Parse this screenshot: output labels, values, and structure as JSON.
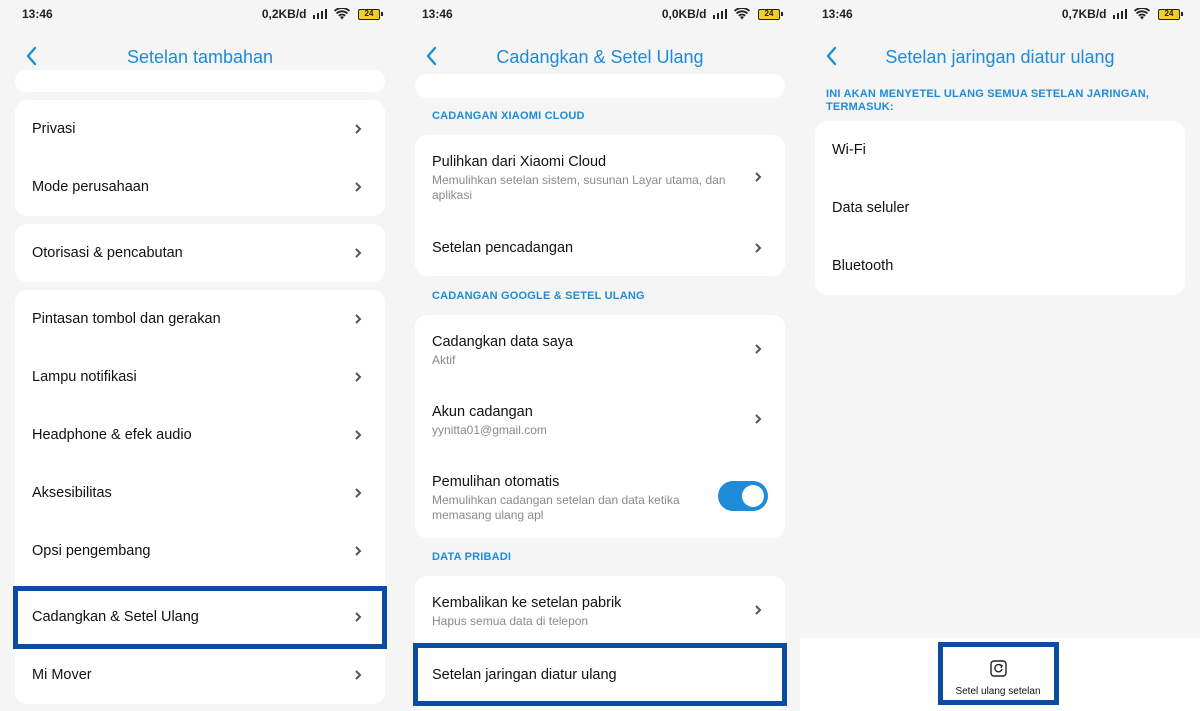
{
  "status": [
    {
      "time": "13:46",
      "speed": "0,2KB/d",
      "battery": "24"
    },
    {
      "time": "13:46",
      "speed": "0,0KB/d",
      "battery": "24"
    },
    {
      "time": "13:46",
      "speed": "0,7KB/d",
      "battery": "24"
    }
  ],
  "screen1": {
    "title": "Setelan tambahan",
    "items": [
      "Privasi",
      "Mode perusahaan",
      "Otorisasi & pencabutan",
      "Pintasan tombol dan gerakan",
      "Lampu notifikasi",
      "Headphone & efek audio",
      "Aksesibilitas",
      "Opsi pengembang",
      "Cadangkan & Setel Ulang",
      "Mi Mover"
    ]
  },
  "screen2": {
    "title": "Cadangkan & Setel Ulang",
    "section_xiaomi": "CADANGAN XIAOMI CLOUD",
    "restore_title": "Pulihkan dari Xiaomi Cloud",
    "restore_sub": "Memulihkan setelan sistem, susunan Layar utama, dan aplikasi",
    "backup_settings": "Setelan pencadangan",
    "section_google": "CADANGAN GOOGLE & SETEL ULANG",
    "backup_data_title": "Cadangkan data saya",
    "backup_data_sub": "Aktif",
    "account_title": "Akun cadangan",
    "account_sub": "yynitta01@gmail.com",
    "auto_restore_title": "Pemulihan otomatis",
    "auto_restore_sub": "Memulihkan cadangan setelan dan data ketika memasang ulang apl",
    "auto_restore_on": true,
    "section_personal": "DATA PRIBADI",
    "factory_title": "Kembalikan ke setelan pabrik",
    "factory_sub": "Hapus semua data di telepon",
    "network_reset": "Setelan jaringan diatur ulang"
  },
  "screen3": {
    "title": "Setelan jaringan diatur ulang",
    "notice": "INI AKAN MENYETEL ULANG SEMUA SETELAN JARINGAN, TERMASUK:",
    "items": [
      "Wi-Fi",
      "Data seluler",
      "Bluetooth"
    ],
    "reset_button": "Setel ulang setelan"
  },
  "icons": {
    "back": "chevron-left-icon",
    "chevron": "chevron-right-icon",
    "wifi": "wifi-icon",
    "signal": "signal-icon",
    "battery": "battery-icon",
    "reset": "reset-icon"
  },
  "colors": {
    "accent": "#1e8bd9",
    "highlight": "#0c4c9c",
    "background": "#f5f5f5",
    "card": "#ffffff"
  }
}
